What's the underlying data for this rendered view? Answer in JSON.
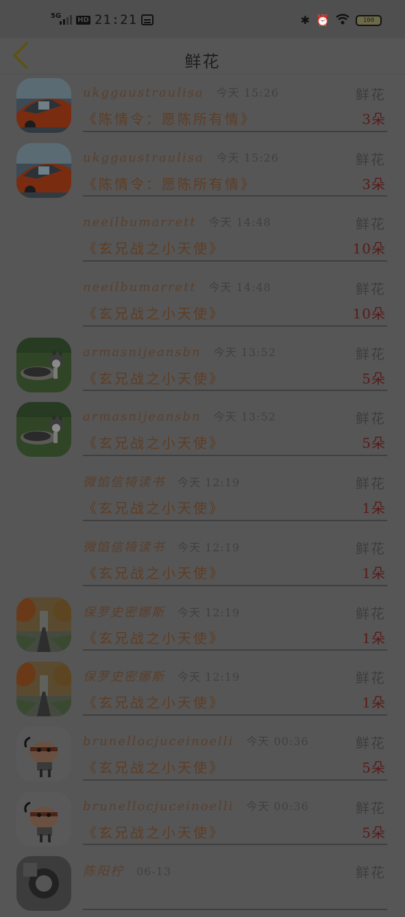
{
  "status": {
    "network": "5G",
    "hd": "HD",
    "time": "21:21",
    "battery": "100"
  },
  "nav": {
    "title": "鲜花"
  },
  "rows": [
    {
      "avatar": "car",
      "name": "ukggaustraulisa",
      "time": "今天 15:26",
      "kind": "鲜花",
      "book": "《陈情令：愿陈所有情》",
      "count": "3朵"
    },
    {
      "avatar": "car",
      "name": "ukggaustraulisa",
      "time": "今天 15:26",
      "kind": "鲜花",
      "book": "《陈情令：愿陈所有情》",
      "count": "3朵"
    },
    {
      "avatar": "none",
      "name": "neeilbumarrett",
      "time": "今天 14:48",
      "kind": "鲜花",
      "book": "《玄兄战之小天使》",
      "count": "10朵"
    },
    {
      "avatar": "none",
      "name": "neeilbumarrett",
      "time": "今天 14:48",
      "kind": "鲜花",
      "book": "《玄兄战之小天使》",
      "count": "10朵"
    },
    {
      "avatar": "dog",
      "name": "armasnijeansbn",
      "time": "今天 13:52",
      "kind": "鲜花",
      "book": "《玄兄战之小天使》",
      "count": "5朵"
    },
    {
      "avatar": "dog",
      "name": "armasnijeansbn",
      "time": "今天 13:52",
      "kind": "鲜花",
      "book": "《玄兄战之小天使》",
      "count": "5朵"
    },
    {
      "avatar": "none",
      "name": "微馅信犄读书",
      "time": "今天 12:19",
      "kind": "鲜花",
      "book": "《玄兄战之小天使》",
      "count": "1朵"
    },
    {
      "avatar": "none",
      "name": "微馅信犄读书",
      "time": "今天 12:19",
      "kind": "鲜花",
      "book": "《玄兄战之小天使》",
      "count": "1朵"
    },
    {
      "avatar": "road",
      "name": "保罗史密娜斯",
      "time": "今天 12:19",
      "kind": "鲜花",
      "book": "《玄兄战之小天使》",
      "count": "1朵"
    },
    {
      "avatar": "road",
      "name": "保罗史密娜斯",
      "time": "今天 12:19",
      "kind": "鲜花",
      "book": "《玄兄战之小天使》",
      "count": "1朵"
    },
    {
      "avatar": "cartoon",
      "name": "brunellocjuceinoelli",
      "time": "今天 00:36",
      "kind": "鲜花",
      "book": "《玄兄战之小天使》",
      "count": "5朵"
    },
    {
      "avatar": "cartoon",
      "name": "brunellocjuceinoelli",
      "time": "今天 00:36",
      "kind": "鲜花",
      "book": "《玄兄战之小天使》",
      "count": "5朵"
    },
    {
      "avatar": "moto",
      "name": "陈阳柠",
      "time": "06-13",
      "kind": "鲜花",
      "book": "",
      "count": ""
    }
  ]
}
